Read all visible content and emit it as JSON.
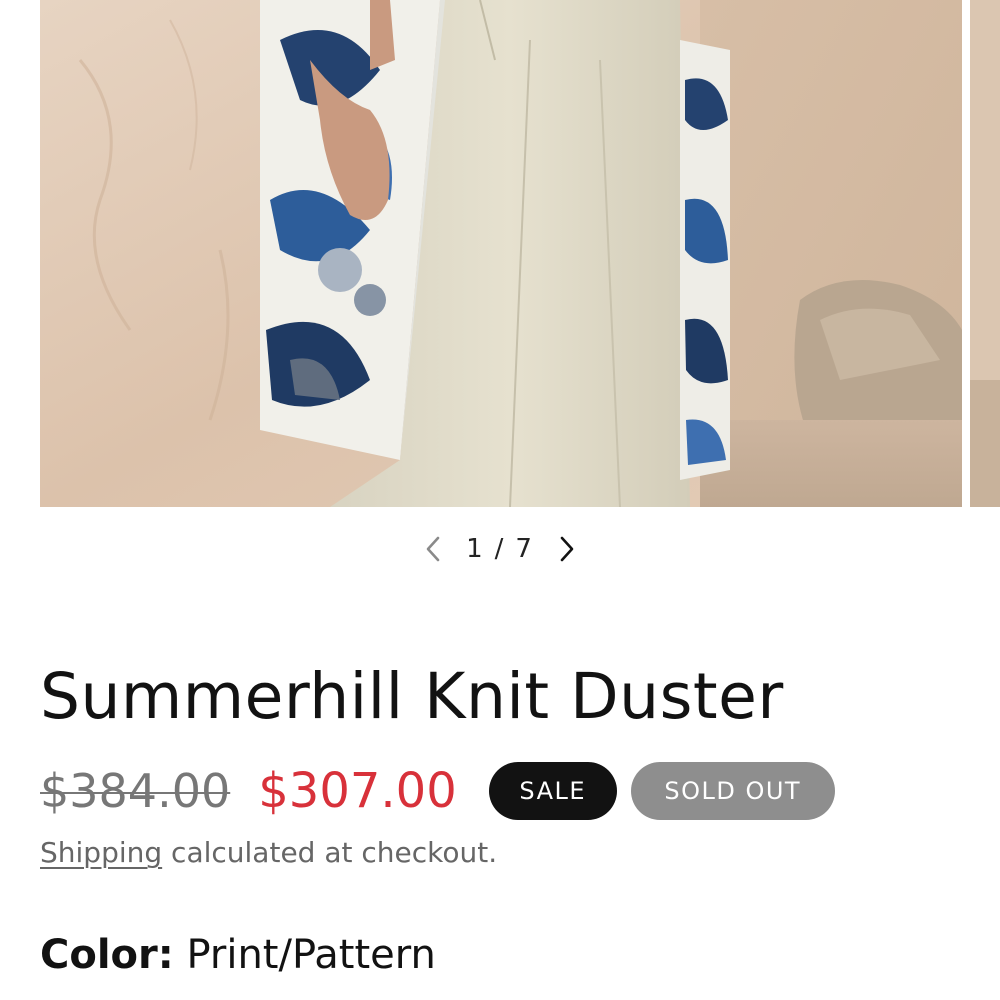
{
  "gallery": {
    "current": "1",
    "separator": "/",
    "total": "7",
    "prev_icon": "chevron-left-icon",
    "next_icon": "chevron-right-icon"
  },
  "product": {
    "title": "Summerhill Knit Duster",
    "price_regular": "$384.00",
    "price_sale": "$307.00",
    "badge_sale": "SALE",
    "badge_sold_out": "SOLD OUT",
    "shipping_link": "Shipping",
    "shipping_text": " calculated at checkout.",
    "variant_name": "Color:",
    "variant_value": " Print/Pattern"
  },
  "colors": {
    "sale_price": "#d8313a",
    "sale_badge": "#121212",
    "sold_out_badge": "#8e8e8e",
    "text": "#121212",
    "muted_text": "#666666"
  }
}
